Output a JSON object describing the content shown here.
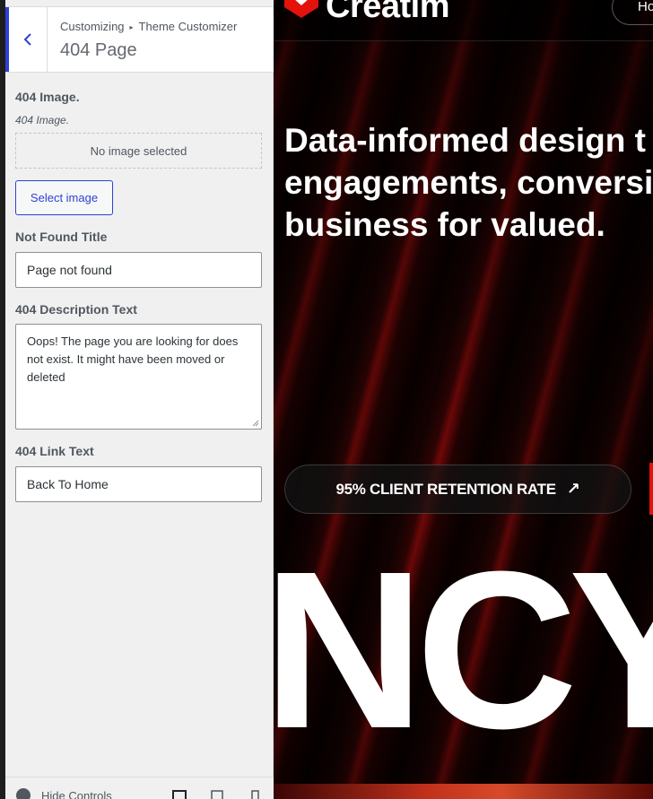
{
  "panel": {
    "breadcrumb": {
      "root": "Customizing",
      "separator": "▸",
      "section": "Theme Customizer"
    },
    "title": "404 Page",
    "image_control": {
      "label": "404 Image.",
      "description": "404 Image.",
      "placeholder": "No image selected",
      "button": "Select image"
    },
    "title_control": {
      "label": "Not Found Title",
      "value": "Page not found"
    },
    "description_control": {
      "label": "404 Description Text",
      "value": "Oops! The page you are looking for does not exist. It might have been moved or deleted"
    },
    "link_control": {
      "label": "404 Link Text",
      "value": "Back To Home"
    },
    "footer": {
      "hide_controls": "Hide Controls"
    },
    "accent_color": "#2e42d4"
  },
  "preview": {
    "logo": "Creatim",
    "nav_button": "Ho",
    "headline": [
      "Data-informed design t",
      "engagements, conversi",
      "business for valued."
    ],
    "retention_button": "95% CLIENT RETENTION RATE",
    "retention_icon": "arrow-up-right-icon",
    "big_text": "NCY C",
    "brand_color": "#e3120b"
  }
}
